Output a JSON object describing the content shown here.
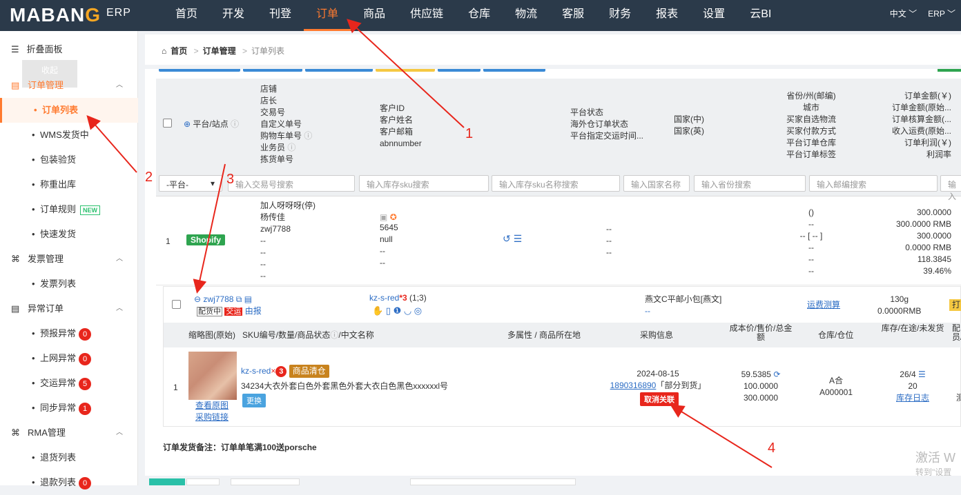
{
  "app": {
    "logo": "MABANG",
    "erp": "ERP"
  },
  "nav": [
    "首页",
    "开发",
    "刊登",
    "订单",
    "商品",
    "供应链",
    "仓库",
    "物流",
    "客服",
    "财务",
    "报表",
    "设置",
    "云BI"
  ],
  "topright": {
    "lang": "中文",
    "erp": "ERP"
  },
  "sidebar": {
    "fold": "折叠面板",
    "fold_tip": "收起",
    "groups": [
      {
        "label": "订单管理",
        "items": [
          "订单列表",
          "WMS发货中",
          "包装验货",
          "称重出库",
          "订单规则",
          "快速发货"
        ]
      },
      {
        "label": "发票管理",
        "items": [
          "发票列表"
        ]
      },
      {
        "label": "异常订单",
        "items": [
          "预报异常",
          "上网异常",
          "交运异常",
          "同步异常"
        ]
      },
      {
        "label": "RMA管理",
        "items": [
          "退货列表",
          "退款列表"
        ]
      }
    ],
    "new_tag": "NEW",
    "badges": {
      "预报异常": "0",
      "上网异常": "0",
      "交运异常": "5",
      "同步异常": "1",
      "退款列表": "0"
    }
  },
  "breadcrumb": {
    "home": "首页",
    "level1": "订单管理",
    "current": "订单列表"
  },
  "table_header": {
    "platform": "平台/站点",
    "shop_col": [
      "店铺",
      "店长",
      "交易号",
      "自定义单号",
      "购物车单号",
      "业务员",
      "拣货单号"
    ],
    "customer_col": [
      "客户ID",
      "客户姓名",
      "客户邮箱",
      "abnnumber"
    ],
    "status_col": [
      "平台状态",
      "海外仓订单状态",
      "平台指定交运时间..."
    ],
    "country_col": [
      "国家(中)",
      "国家(英)"
    ],
    "province_col": [
      "省份/州(邮编)",
      "城市",
      "买家自选物流",
      "买家付款方式",
      "平台订单仓库",
      "平台订单标签"
    ],
    "amount_col": [
      "订单金额(￥)",
      "订单金额(原始...",
      "订单核算金额(...",
      "收入运费(原始...",
      "订单利润(￥)",
      "利润率"
    ]
  },
  "filters": {
    "platform_select": "-平台-",
    "trade_no": "输入交易号搜索",
    "sku": "输入库存sku搜索",
    "sku_name": "输入库存sku名称搜索",
    "country": "输入国家名称",
    "province": "输入省份搜索",
    "email": "输入邮编搜索",
    "more": "输入"
  },
  "order": {
    "index": "1",
    "platform": "Shopify",
    "shop_lines": [
      "加人呀呀呀(停)",
      "杨传佳",
      "zwj7788",
      "--",
      "--",
      "--",
      "--"
    ],
    "customer_lines": [
      "5645",
      "null",
      "--",
      "--"
    ],
    "status_lines": [
      "--",
      "--",
      "--"
    ],
    "province_lines": [
      "()",
      "--",
      "-- [ -- ]",
      "--",
      "--",
      "--"
    ],
    "amount_lines": [
      "300.0000",
      "300.0000 RMB",
      "300.0000",
      "0.0000 RMB",
      "118.3845",
      "39.46%"
    ]
  },
  "package": {
    "id": "zwj7788",
    "tags": [
      "配货中",
      "交运"
    ],
    "report": "由报",
    "sku_summary": "kz-s-red",
    "sku_count": "*3",
    "sku_ratio": "(1;3)",
    "logistics": "燕文C平邮小包[燕文]",
    "logistics_sub": "--",
    "freight_calc": "运费测算",
    "weight": "130g",
    "weight_fee": "0.0000RMB",
    "action_btn": "打"
  },
  "sub_header": [
    "缩略图(原始)",
    "SKU编号/数量/商品状态",
    "/中文名称",
    "多属性 / 商品所在地",
    "采购信息",
    "成本价/售价/总金额",
    "仓库/仓位",
    "库存/在途/未发货",
    "配员/"
  ],
  "item": {
    "index": "1",
    "view_image": "查看原图",
    "purchase_link": "采购链接",
    "sku": "kz-s-red",
    "qty": "3",
    "status_tag": "商品清仓",
    "name": "34234大衣外套白色外套黑色外套大衣白色黑色xxxxxxl号",
    "change_btn": "更换",
    "purchase_date": "2024-08-15",
    "purchase_no": "1890316890",
    "purchase_status": "「部分到货」",
    "unlink_btn": "取消关联",
    "cost": "59.5385",
    "price": "100.0000",
    "total": "300.0000",
    "warehouse": "A合",
    "location": "A000001",
    "stock": "26/4",
    "intransit": "20",
    "stock_log": "库存日志",
    "last_col": "测"
  },
  "remark": "订单发货备注：订单单笔满100送porsche",
  "annotations": [
    "1",
    "2",
    "3",
    "4"
  ],
  "watermark": {
    "line1": "激活 W",
    "line2": "转到\"设置"
  },
  "colors": {
    "accent": "#ff7a2f",
    "topbar": "#2b3a4a",
    "red": "#e8261c",
    "link": "#2b6cc4",
    "shopify": "#2ea44f"
  }
}
